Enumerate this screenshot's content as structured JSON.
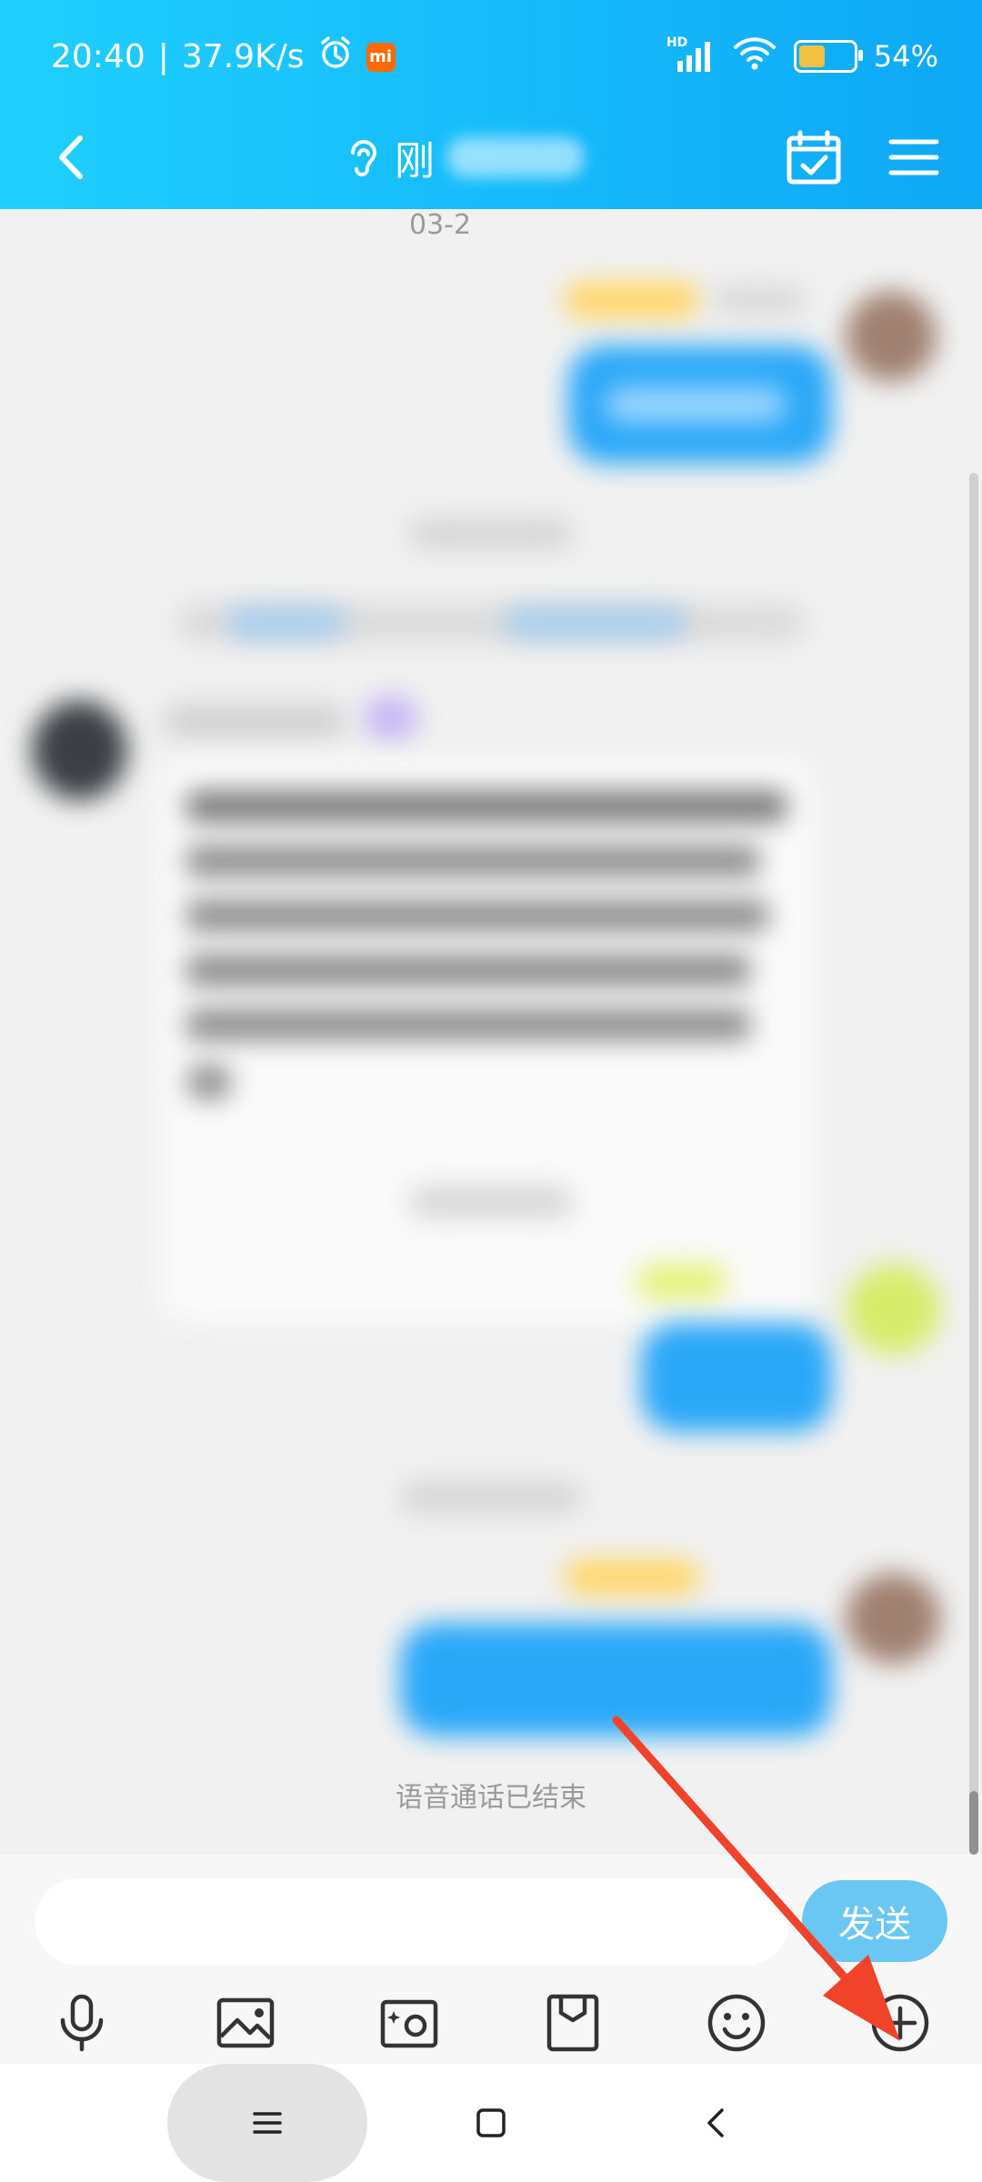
{
  "status_bar": {
    "time": "20:40",
    "separator": "|",
    "network_speed": "37.9K/s",
    "alarm_icon": "alarm-icon",
    "mi_badge": "mi",
    "signal_label": "HD",
    "battery_percent": "54%",
    "battery_level": 0.54,
    "battery_color": "#f1c241"
  },
  "header": {
    "back_icon": "chevron-left-icon",
    "listen_icon": "ear-icon",
    "title_visible": "刚",
    "calendar_icon": "calendar-check-icon",
    "menu_icon": "hamburger-menu-icon",
    "gradient_start": "#1fd0ff",
    "gradient_end": "#0ea8f6"
  },
  "chat": {
    "date_label": "03-2",
    "call_ended_text": "语音通话已结束"
  },
  "input_bar": {
    "message_value": "",
    "send_label": "发送",
    "send_color": "#6ac6f3",
    "tools": [
      "microphone-icon",
      "image-icon",
      "camera-icon",
      "file-icon",
      "emoji-icon",
      "plus-circle-icon"
    ]
  },
  "system_nav": {
    "menu_icon": "menu-icon",
    "home_icon": "home-square-icon",
    "back_icon": "back-chevron-icon"
  },
  "annotation": {
    "arrow_color": "#f0432a"
  }
}
